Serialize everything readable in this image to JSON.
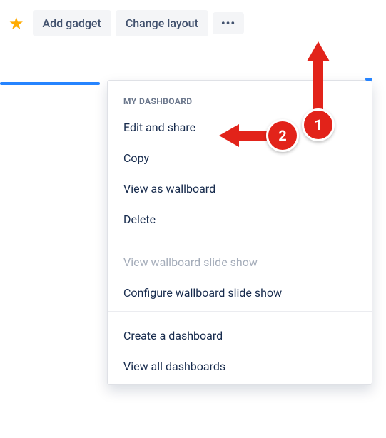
{
  "toolbar": {
    "add_gadget_label": "Add gadget",
    "change_layout_label": "Change layout"
  },
  "menu": {
    "section_title": "MY DASHBOARD",
    "items_a": {
      "edit_share": "Edit and share",
      "copy": "Copy",
      "view_wallboard": "View as wallboard",
      "delete": "Delete"
    },
    "items_b": {
      "view_slideshow": "View wallboard slide show",
      "configure_slideshow": "Configure wallboard slide show"
    },
    "items_c": {
      "create_dashboard": "Create a dashboard",
      "view_all": "View all dashboards"
    }
  },
  "callouts": {
    "one": "1",
    "two": "2"
  }
}
